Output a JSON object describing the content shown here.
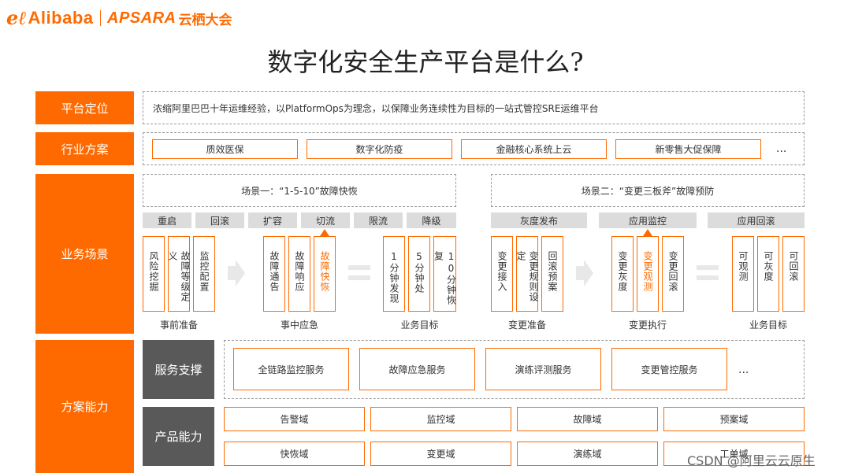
{
  "logo": {
    "icon": "eℓ",
    "brand": "Alibaba",
    "sub": "APSARA",
    "cn": "云栖大会"
  },
  "title": "数字化安全生产平台是什么?",
  "platform": {
    "label": "平台定位",
    "text": "浓缩阿里巴巴十年运维经验，以PlatformOps为理念，以保障业务连续性为目标的一站式管控SRE运维平台"
  },
  "industry": {
    "label": "行业方案",
    "items": [
      "质效医保",
      "数字化防疫",
      "金融核心系统上云",
      "新零售大促保障"
    ],
    "more": "..."
  },
  "business": {
    "label": "业务场景",
    "scene1": "场景一：“1-5-10”故障快恢",
    "scene2": "场景二：“变更三板斧”故障预防",
    "tags1": [
      "重启",
      "回滚",
      "扩容",
      "切流",
      "限流",
      "降级"
    ],
    "tags2": [
      "灰度发布",
      "应用监控",
      "应用回滚"
    ],
    "g1": [
      "风险挖掘",
      "故障等级定义",
      "监控配置"
    ],
    "g2": [
      "故障通告",
      "故障响应",
      "故障快恢"
    ],
    "g3": [
      "1分钟发现",
      "5分钟处",
      "10分钟恢复"
    ],
    "g4": [
      "变更接入",
      "变更规则设定",
      "回滚预案"
    ],
    "g5": [
      "变更灰度",
      "变更观测",
      "变更回滚"
    ],
    "g6": [
      "可观测",
      "可灰度",
      "可回滚"
    ],
    "labels": [
      "事前准备",
      "事中应急",
      "业务目标",
      "变更准备",
      "变更执行",
      "业务目标"
    ]
  },
  "capability": {
    "label": "方案能力",
    "service_label": "服务支撑",
    "services": [
      "全链路监控服务",
      "故障应急服务",
      "演练评测服务",
      "变更管控服务"
    ],
    "more": "...",
    "product_label": "产品能力",
    "products_row1": [
      "告警域",
      "监控域",
      "故障域",
      "预案域"
    ],
    "products_row2": [
      "快恢域",
      "变更域",
      "演练域",
      "工单域"
    ]
  },
  "watermark": "CSDN @阿里云云原生",
  "colors": {
    "accent": "#ff6a00",
    "dark": "#595959",
    "gray": "#dcdcdc"
  }
}
